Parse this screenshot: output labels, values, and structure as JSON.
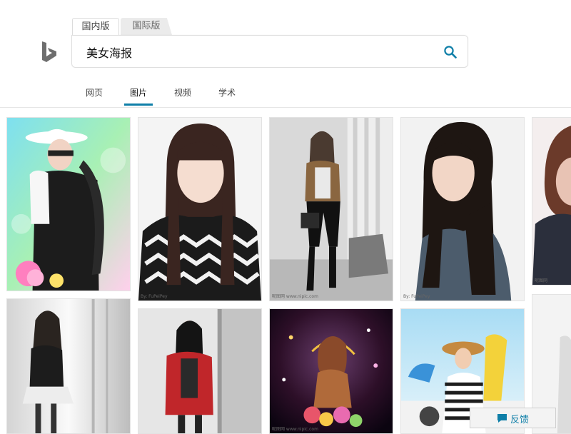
{
  "scope_tabs": {
    "domestic": "国内版",
    "international": "国际版"
  },
  "search": {
    "query": "美女海报"
  },
  "nav": {
    "items": [
      "网页",
      "图片",
      "视频",
      "学术"
    ],
    "active_index": 1
  },
  "results": [
    {
      "watermark": ""
    },
    {
      "watermark": "By: FuPeiPey"
    },
    {
      "watermark": "昵图网 www.nipic.com"
    },
    {
      "watermark": "By: FuPeiPey"
    },
    {
      "watermark": "昵图网"
    },
    {
      "watermark": ""
    },
    {
      "watermark": ""
    },
    {
      "watermark": "昵图网 www.nipic.com"
    },
    {
      "watermark": ""
    },
    {
      "watermark": ""
    }
  ],
  "feedback": {
    "label": "反馈"
  },
  "colors": {
    "accent": "#0f7fa8",
    "logo": "#6e6e6e"
  }
}
